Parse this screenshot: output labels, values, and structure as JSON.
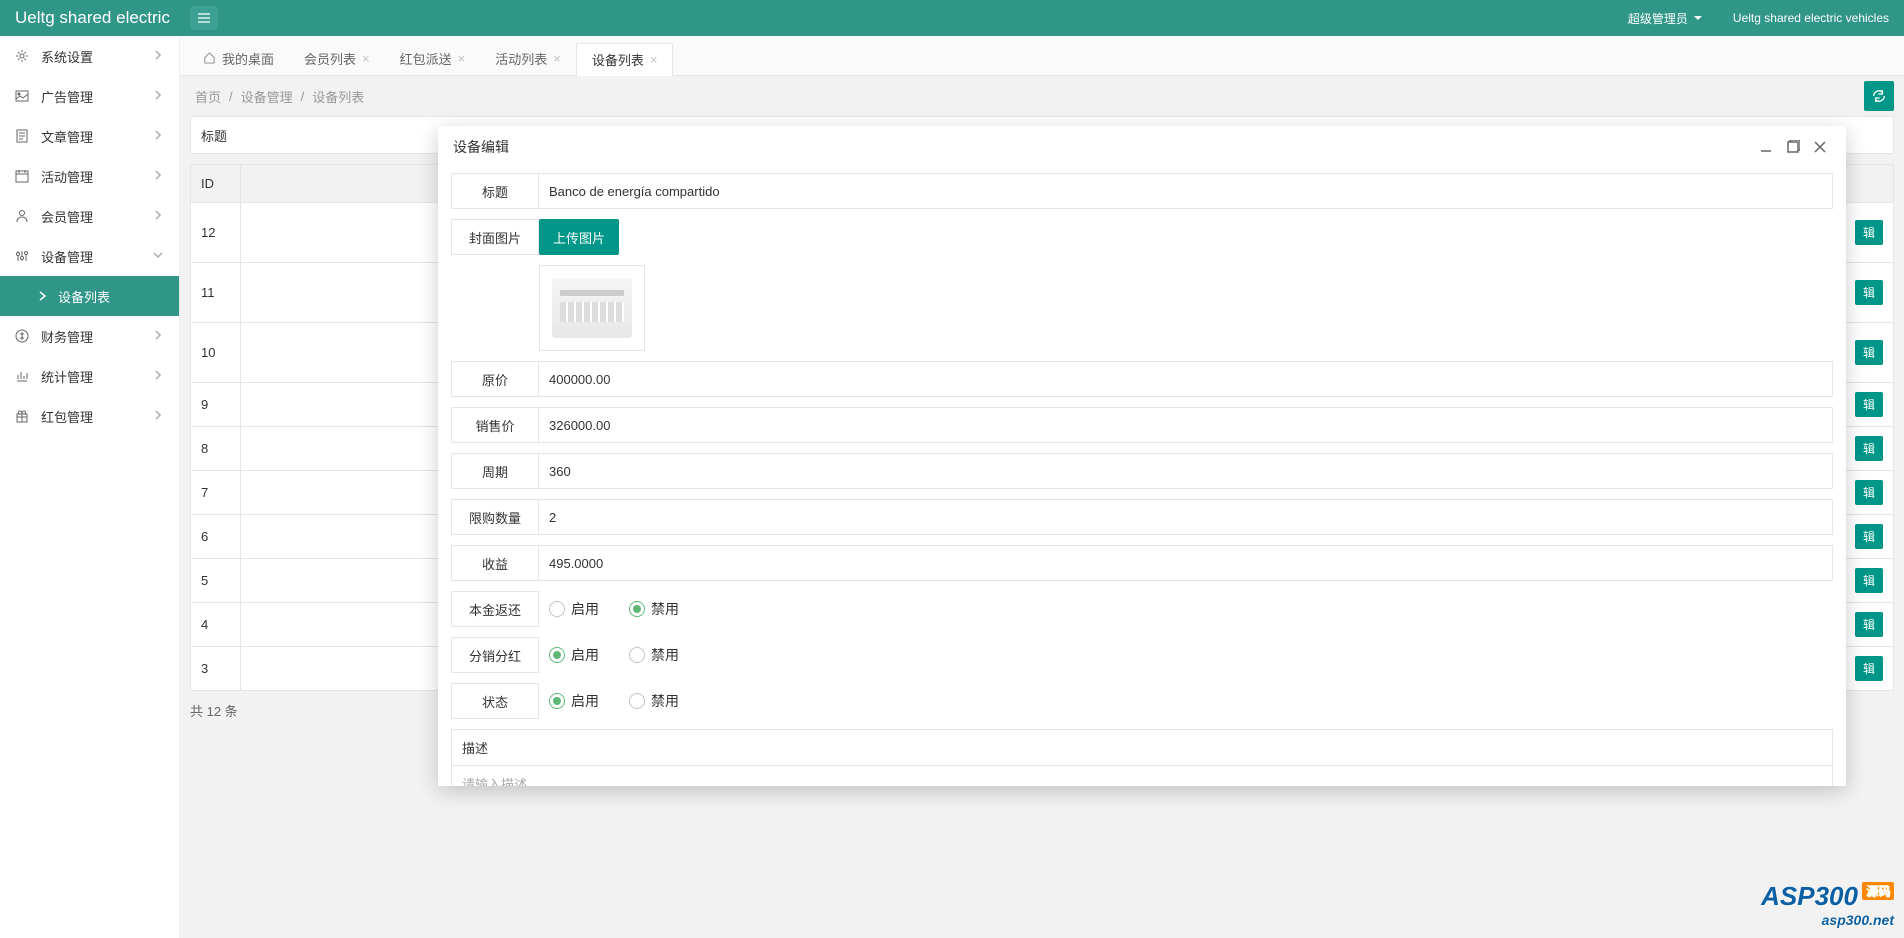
{
  "header": {
    "brand": "Ueltg shared electric",
    "user": "超级管理员",
    "suffix": "Ueltg shared electric vehicles"
  },
  "sidebar": {
    "items": [
      {
        "label": "系统设置",
        "icon": "gear"
      },
      {
        "label": "广告管理",
        "icon": "image"
      },
      {
        "label": "文章管理",
        "icon": "file"
      },
      {
        "label": "活动管理",
        "icon": "calendar"
      },
      {
        "label": "会员管理",
        "icon": "user"
      },
      {
        "label": "设备管理",
        "icon": "sliders",
        "expanded": true
      },
      {
        "label": "财务管理",
        "icon": "coin"
      },
      {
        "label": "统计管理",
        "icon": "chart"
      },
      {
        "label": "红包管理",
        "icon": "gift"
      }
    ],
    "subitem": "设备列表"
  },
  "tabs": [
    {
      "label": "我的桌面",
      "home": true
    },
    {
      "label": "会员列表",
      "close": true
    },
    {
      "label": "红包派送",
      "close": true
    },
    {
      "label": "活动列表",
      "close": true
    },
    {
      "label": "设备列表",
      "close": true,
      "active": true
    }
  ],
  "breadcrumb": {
    "home": "首页",
    "mid": "设备管理",
    "last": "设备列表",
    "sep": "/"
  },
  "bg": {
    "filter_label": "标题",
    "cols": {
      "id": "ID"
    },
    "rows": [
      "12",
      "11",
      "10",
      "9",
      "8",
      "7",
      "6",
      "5",
      "4",
      "3"
    ],
    "edit": "辑",
    "total": "共 12 条"
  },
  "modal": {
    "title": "设备编辑",
    "fields": {
      "title_label": "标题",
      "title_value": "Banco de energía compartido",
      "cover_label": "封面图片",
      "upload_btn": "上传图片",
      "price_label": "原价",
      "price_value": "400000.00",
      "sale_label": "销售价",
      "sale_value": "326000.00",
      "period_label": "周期",
      "period_value": "360",
      "limit_label": "限购数量",
      "limit_value": "2",
      "income_label": "收益",
      "income_value": "495.0000",
      "return_label": "本金返还",
      "dividend_label": "分销分红",
      "status_label": "状态",
      "enable": "启用",
      "disable": "禁用",
      "desc_label": "描述",
      "desc_placeholder": "请输入描述"
    },
    "radios": {
      "return": "disable",
      "dividend": "enable",
      "status": "enable"
    }
  },
  "watermark": {
    "l1": "ASP300",
    "tag": "源码",
    "l2": "asp300.net"
  }
}
